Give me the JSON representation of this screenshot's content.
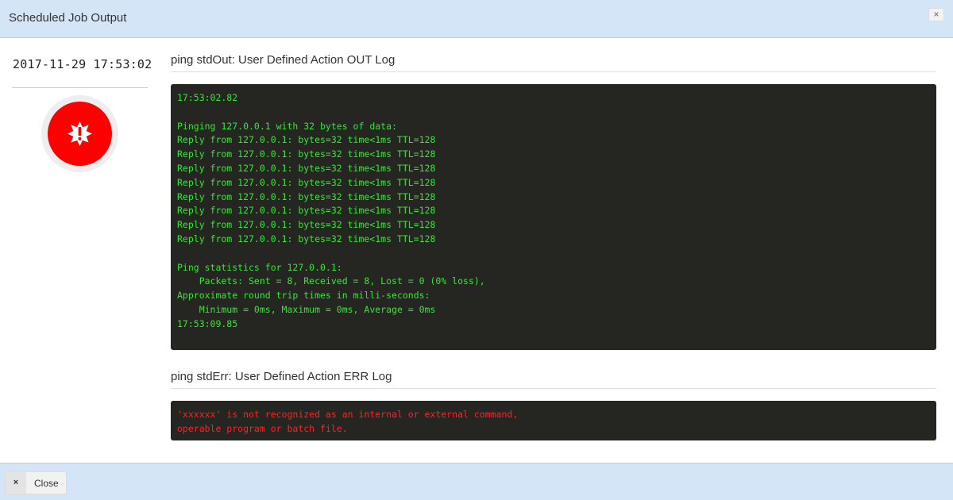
{
  "header": {
    "title": "Scheduled Job Output",
    "close_icon": "×"
  },
  "job": {
    "timestamp": "2017-11-29 17:53:02",
    "status_icon": "error-burst-icon",
    "status_color": "#ff0000"
  },
  "stdout": {
    "title": "ping stdOut: User Defined Action OUT Log",
    "color": "#33e833",
    "lines": [
      "17:53:02.82",
      "",
      "Pinging 127.0.0.1 with 32 bytes of data:",
      "Reply from 127.0.0.1: bytes=32 time<1ms TTL=128",
      "Reply from 127.0.0.1: bytes=32 time<1ms TTL=128",
      "Reply from 127.0.0.1: bytes=32 time<1ms TTL=128",
      "Reply from 127.0.0.1: bytes=32 time<1ms TTL=128",
      "Reply from 127.0.0.1: bytes=32 time<1ms TTL=128",
      "Reply from 127.0.0.1: bytes=32 time<1ms TTL=128",
      "Reply from 127.0.0.1: bytes=32 time<1ms TTL=128",
      "Reply from 127.0.0.1: bytes=32 time<1ms TTL=128",
      "",
      "Ping statistics for 127.0.0.1:",
      "    Packets: Sent = 8, Received = 8, Lost = 0 (0% loss),",
      "Approximate round trip times in milli-seconds:",
      "    Minimum = 0ms, Maximum = 0ms, Average = 0ms",
      "17:53:09.85"
    ]
  },
  "stderr": {
    "title": "ping stdErr: User Defined Action ERR Log",
    "color": "#ff2222",
    "lines": [
      "'xxxxxx' is not recognized as an internal or external command,",
      "operable program or batch file."
    ]
  },
  "footer": {
    "close_icon": "×",
    "close_label": "Close"
  }
}
